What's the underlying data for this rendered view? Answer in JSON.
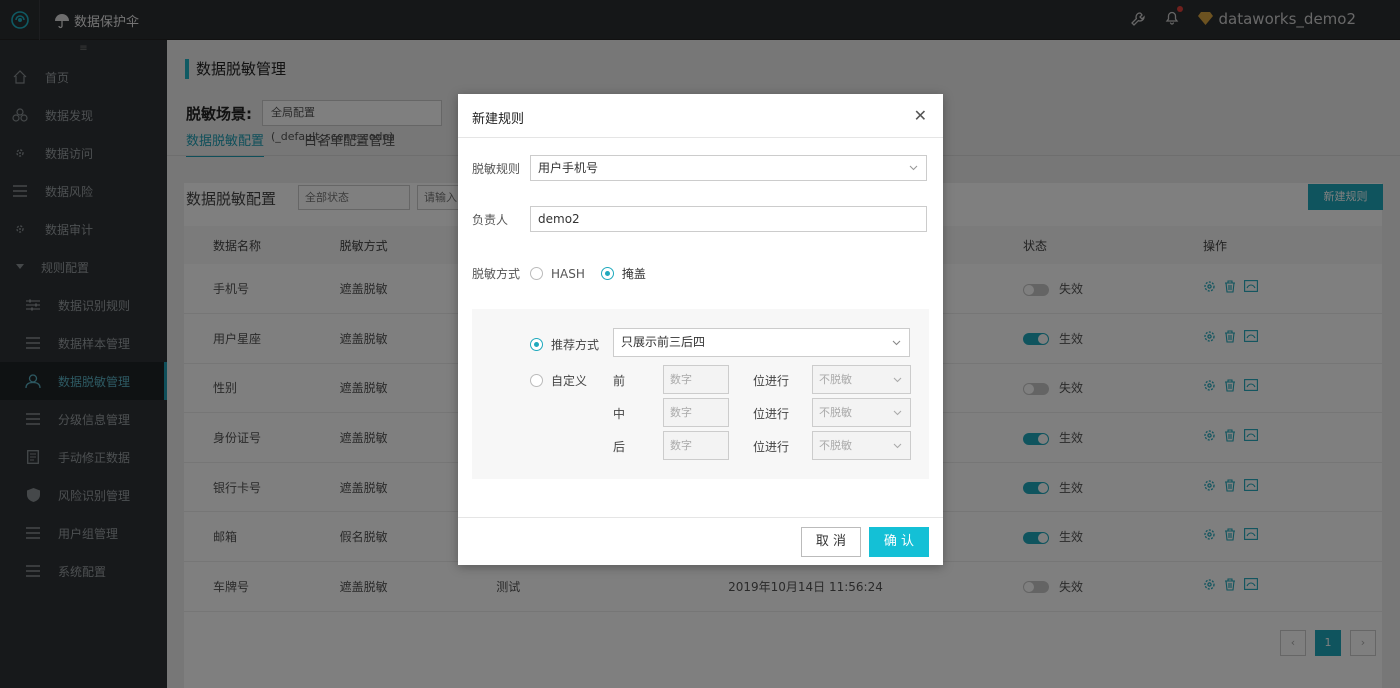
{
  "app": {
    "title": "数据保护伞",
    "user": "dataworks_demo2"
  },
  "sidebar": {
    "items": [
      {
        "label": "首页",
        "icon": "home-icon"
      },
      {
        "label": "数据发现",
        "icon": "discover-icon"
      },
      {
        "label": "数据访问",
        "icon": "access-icon"
      },
      {
        "label": "数据风险",
        "icon": "risk-icon"
      },
      {
        "label": "数据审计",
        "icon": "audit-icon"
      },
      {
        "label": "规则配置",
        "icon": "caret-down-icon"
      },
      {
        "label": "数据识别规则",
        "icon": "sliders-icon"
      },
      {
        "label": "数据样本管理",
        "icon": "list-icon"
      },
      {
        "label": "数据脱敏管理",
        "icon": "user-mask-icon"
      },
      {
        "label": "分级信息管理",
        "icon": "list-icon"
      },
      {
        "label": "手动修正数据",
        "icon": "document-icon"
      },
      {
        "label": "风险识别管理",
        "icon": "shield-icon"
      },
      {
        "label": "用户组管理",
        "icon": "list-icon"
      },
      {
        "label": "系统配置",
        "icon": "list-icon"
      }
    ]
  },
  "page": {
    "title": "数据脱敏管理",
    "scene_label": "脱敏场景:",
    "scene_value": "全局配置 (_default_scene_code)",
    "tabs": [
      "数据脱敏配置",
      "白名单配置管理"
    ],
    "section_title": "数据脱敏配置",
    "status_filter": "全部状态",
    "search_placeholder": "请输入",
    "new_button": "新建规则"
  },
  "table": {
    "headers": [
      "数据名称",
      "脱敏方式",
      "",
      "",
      "状态",
      "操作"
    ],
    "rows": [
      {
        "name": "手机号",
        "method": "遮盖脱敏",
        "note": "",
        "time": "",
        "status_on": false,
        "status": "失效"
      },
      {
        "name": "用户星座",
        "method": "遮盖脱敏",
        "note": "",
        "time": "",
        "status_on": true,
        "status": "生效"
      },
      {
        "name": "性别",
        "method": "遮盖脱敏",
        "note": "",
        "time": "",
        "status_on": false,
        "status": "失效"
      },
      {
        "name": "身份证号",
        "method": "遮盖脱敏",
        "note": "",
        "time": "",
        "status_on": true,
        "status": "生效"
      },
      {
        "name": "银行卡号",
        "method": "遮盖脱敏",
        "note": "",
        "time": "",
        "status_on": true,
        "status": "生效"
      },
      {
        "name": "邮箱",
        "method": "假名脱敏",
        "note": "",
        "time": "",
        "status_on": true,
        "status": "生效"
      },
      {
        "name": "车牌号",
        "method": "遮盖脱敏",
        "note": "测试",
        "time": "2019年10月14日 11:56:24",
        "status_on": false,
        "status": "失效"
      }
    ]
  },
  "pagination": {
    "prev": "‹",
    "current": "1",
    "next": "›"
  },
  "modal": {
    "title": "新建规则",
    "rule_label": "脱敏规则",
    "rule_value": "用户手机号",
    "owner_label": "负责人",
    "owner_value": "demo2",
    "method_label": "脱敏方式",
    "method_options": [
      "HASH",
      "掩盖"
    ],
    "recommend_label": "推荐方式",
    "recommend_value": "只展示前三后四",
    "custom_label": "自定义",
    "positions": [
      "前",
      "中",
      "后"
    ],
    "number_placeholder": "数字",
    "unit_label": "位进行",
    "mask_placeholder": "不脱敏",
    "cancel": "取 消",
    "confirm": "确 认"
  }
}
